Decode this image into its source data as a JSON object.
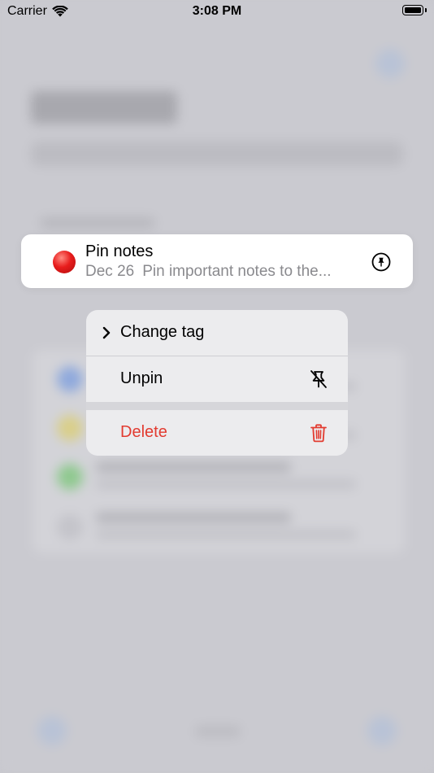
{
  "status_bar": {
    "carrier": "Carrier",
    "time": "3:08 PM",
    "wifi_icon": "wifi-icon",
    "battery_icon": "battery-icon"
  },
  "note": {
    "title": "Pin notes",
    "date": "Dec 26",
    "preview": "Pin important notes to the...",
    "tag_color": "#e81d1d",
    "tag_icon": "red-circle-icon",
    "pin_icon": "pin-icon"
  },
  "menu": {
    "change_tag": "Change tag",
    "change_tag_icon": "chevron-right-icon",
    "unpin": "Unpin",
    "unpin_icon": "pin-slash-icon",
    "delete": "Delete",
    "delete_icon": "trash-icon",
    "delete_color": "#e23b30"
  }
}
